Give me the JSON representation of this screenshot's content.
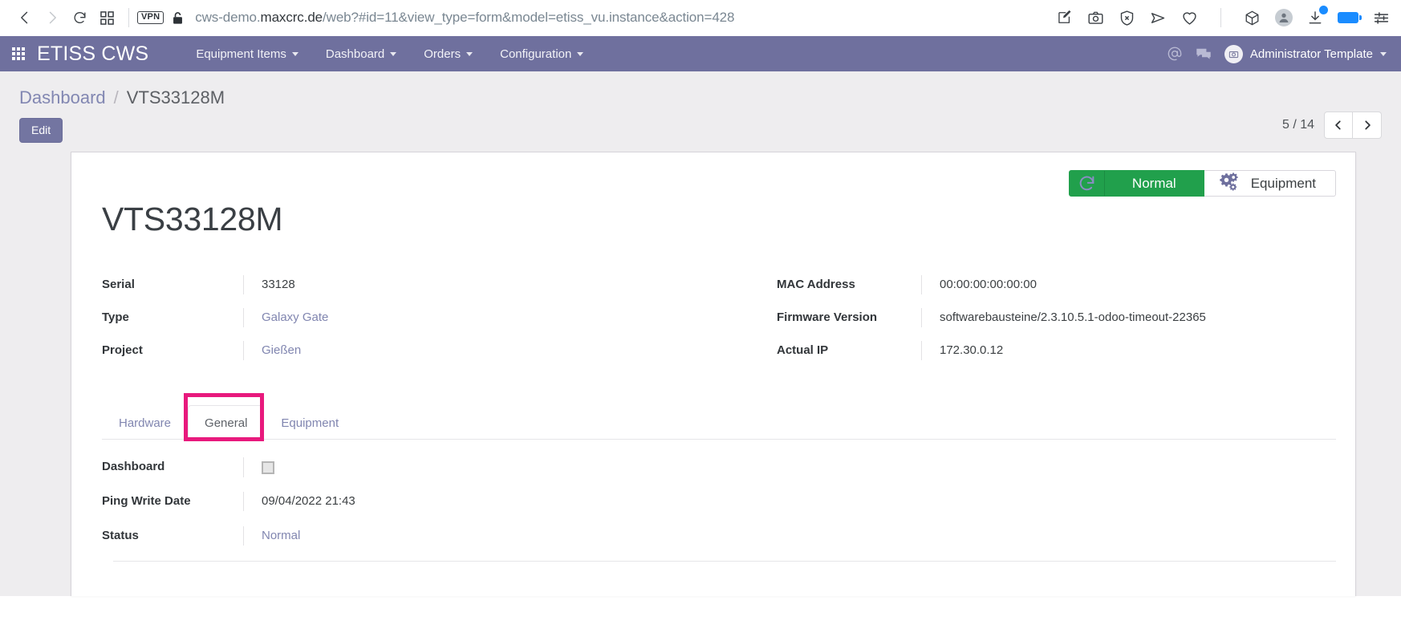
{
  "browser": {
    "back_icon": "back-arrow-icon",
    "forward_icon": "forward-arrow-icon",
    "reload_icon": "reload-icon",
    "tabs_icon": "tab-grid-icon",
    "vpn_badge": "VPN",
    "lock_icon": "lock-icon",
    "url_prefix": "cws-demo.",
    "url_domain": "maxcrc.de",
    "url_suffix": "/web?#id=11&view_type=form&model=etiss_vu.instance&action=428",
    "url_full": "cws-demo.maxcrc.de/web?#id=11&view_type=form&model=etiss_vu.instance&action=428",
    "right_icons": [
      {
        "name": "edit-pin-icon"
      },
      {
        "name": "screenshot-camera-icon"
      },
      {
        "name": "block-shield-icon"
      },
      {
        "name": "send-paper-plane-icon"
      },
      {
        "name": "favorite-heart-icon"
      },
      {
        "name": "package-cube-icon"
      },
      {
        "name": "profile-avatar-icon"
      },
      {
        "name": "download-icon"
      },
      {
        "name": "battery-icon"
      },
      {
        "name": "settings-sliders-icon"
      }
    ]
  },
  "appbar": {
    "apps_grid_icon": "apps-grid-icon",
    "brand": "ETISS CWS",
    "menu": [
      {
        "label": "Equipment Items",
        "caret": true
      },
      {
        "label": "Dashboard",
        "caret": true
      },
      {
        "label": "Orders",
        "caret": true
      },
      {
        "label": "Configuration",
        "caret": true
      }
    ],
    "mention_icon": "at-mention-icon",
    "messages_icon": "chat-bubbles-icon",
    "user_name": "Administrator Template",
    "user_avatar_icon": "user-photo-icon"
  },
  "breadcrumb": {
    "root": "Dashboard",
    "separator": "/",
    "current": "VTS33128M"
  },
  "controls": {
    "edit_label": "Edit",
    "pager_text": "5 / 14",
    "prev_icon": "chevron-left-icon",
    "next_icon": "chevron-right-icon"
  },
  "record": {
    "title": "VTS33128M",
    "status_button": {
      "refresh_icon": "refresh-circular-icon",
      "label": "Normal",
      "color": "#21a04c"
    },
    "equipment_button": {
      "icon": "gears-icon",
      "label": "Equipment"
    },
    "left_fields": [
      {
        "label": "Serial",
        "value": "33128",
        "link": false
      },
      {
        "label": "Type",
        "value": "Galaxy Gate",
        "link": true
      },
      {
        "label": "Project",
        "value": "Gießen",
        "link": true
      }
    ],
    "right_fields": [
      {
        "label": "MAC Address",
        "value": "00:00:00:00:00:00",
        "link": false
      },
      {
        "label": "Firmware Version",
        "value": "softwarebausteine/2.3.10.5.1-odoo-timeout-22365",
        "link": false
      },
      {
        "label": "Actual IP",
        "value": "172.30.0.12",
        "link": false
      }
    ]
  },
  "tabs": {
    "items": [
      {
        "label": "Hardware",
        "active": false
      },
      {
        "label": "General",
        "active": true
      },
      {
        "label": "Equipment",
        "active": false
      }
    ],
    "highlight_color": "#e8197d"
  },
  "general_tab": {
    "fields": [
      {
        "label": "Dashboard",
        "value": "",
        "type": "checkbox",
        "checked": false
      },
      {
        "label": "Ping Write Date",
        "value": "09/04/2022 21:43",
        "type": "text",
        "link": false
      },
      {
        "label": "Status",
        "value": "Normal",
        "type": "text",
        "link": true
      }
    ]
  },
  "theme": {
    "appbar_bg": "#6f709e",
    "page_bg": "#eeedef",
    "accent": "#7375a1",
    "link": "#8186b0",
    "status_green": "#21a04c",
    "highlight_pink": "#e8197d"
  }
}
